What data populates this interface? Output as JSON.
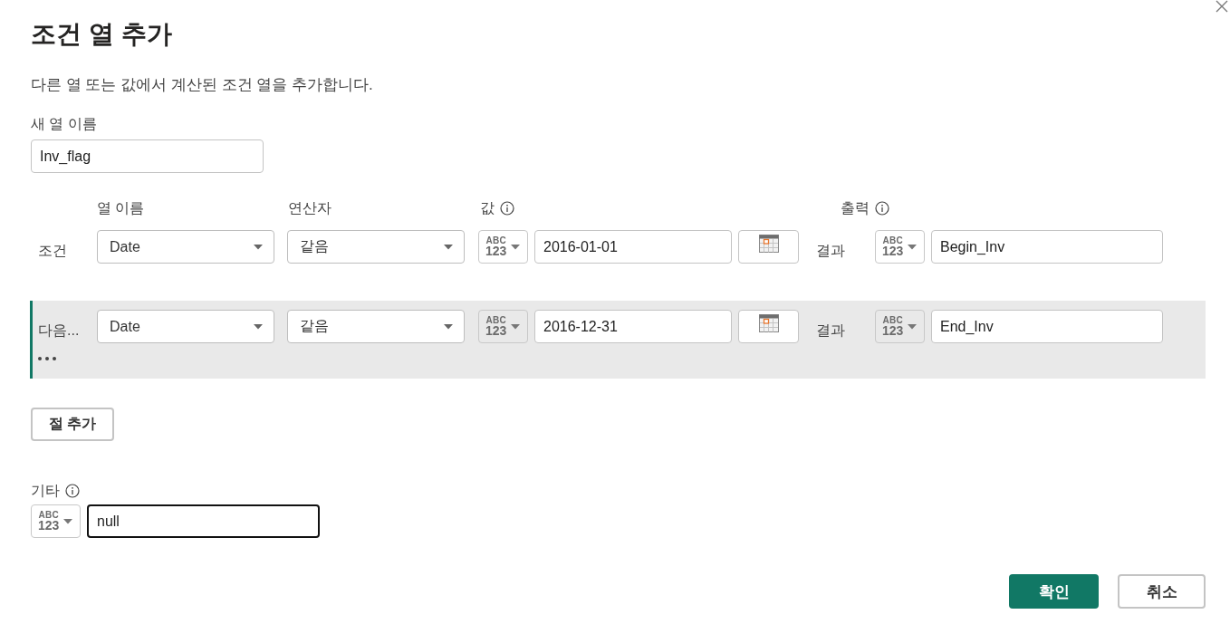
{
  "dialog": {
    "title": "조건 열 추가",
    "description": "다른 열 또는 값에서 계산된 조건 열을 추가합니다."
  },
  "new_column": {
    "label": "새 열 이름",
    "value": "Inv_flag"
  },
  "column_headers": [
    {
      "label": "열 이름",
      "info": false
    },
    {
      "label": "연산자",
      "info": false
    },
    {
      "label": "값",
      "info": true
    },
    {
      "label": "출력",
      "info": true
    }
  ],
  "clauses": [
    {
      "label": "조건",
      "selected": false,
      "column": "Date",
      "operator": "같음",
      "value_type": [
        "ABC",
        "123"
      ],
      "value": "2016-01-01",
      "result_label": "결과",
      "output_type": [
        "ABC",
        "123"
      ],
      "output": "Begin_Inv"
    },
    {
      "label": "다음...",
      "selected": true,
      "column": "Date",
      "operator": "같음",
      "value_type": [
        "ABC",
        "123"
      ],
      "value": "2016-12-31",
      "result_label": "결과",
      "output_type": [
        "ABC",
        "123"
      ],
      "output": "End_Inv"
    }
  ],
  "add_clause_button": "절 추가",
  "else": {
    "label": "기타",
    "info": true,
    "type": [
      "ABC",
      "123"
    ],
    "value": "null",
    "focused": true
  },
  "buttons": [
    {
      "label": "확인",
      "kind": "primary"
    },
    {
      "label": "취소",
      "kind": "secondary"
    }
  ]
}
